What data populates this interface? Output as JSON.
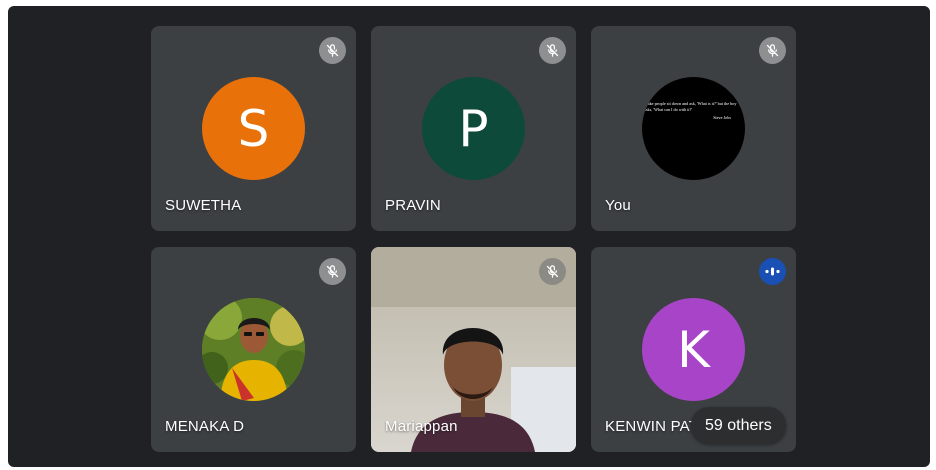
{
  "participants": [
    {
      "name": "SUWETHA",
      "initial": "S",
      "color": "#e8710a",
      "mic": "muted"
    },
    {
      "name": "PRAVIN",
      "initial": "P",
      "color": "#0d4a3a",
      "mic": "muted"
    },
    {
      "name": "You",
      "avatar_quote": "Make people sit down and ask, 'What is it?' but the boy asks, 'What can I do with it?'",
      "avatar_quote_author": "Steve Jobs",
      "mic": "muted"
    },
    {
      "name": "MENAKA D",
      "mic": "muted"
    },
    {
      "name": "Mariappan",
      "mic": "muted"
    },
    {
      "name": "KENWIN PAT",
      "initial": "K",
      "color": "#a844c8",
      "mic": "speaking"
    }
  ],
  "others_label": "59 others",
  "icons": {
    "muted": "mic-off-icon",
    "speaking": "audio-level-icon"
  }
}
